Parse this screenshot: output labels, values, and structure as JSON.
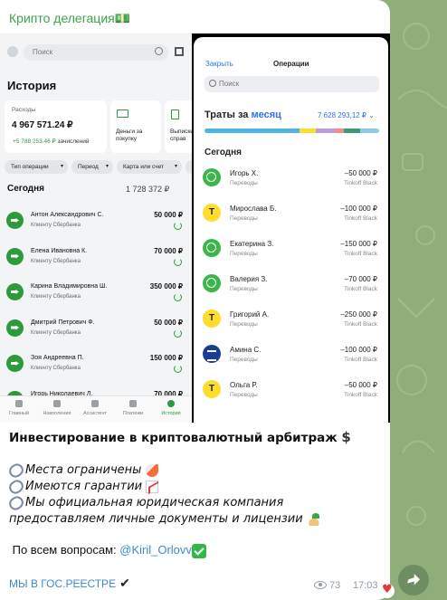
{
  "channel": {
    "title": "Крипто делегация",
    "title_emoji": "💵"
  },
  "sber": {
    "search_placeholder": "Поиск",
    "heading": "История",
    "expenses_label": "Расходы",
    "expenses_value": "4 967 571.24 ₽",
    "income_value": "+5 788 253.46 ₽",
    "income_suffix": "зачислений",
    "pay_card_label": "Деньги за покупку",
    "extract_card_label": "Выписки и справ",
    "filters": [
      "Тип операции",
      "Период",
      "Карта или счет",
      "Т"
    ],
    "today_label": "Сегодня",
    "today_total": "1 728 372 ₽",
    "transactions": [
      {
        "name": "Антон Александрович С.",
        "sub": "Клиенту Сбербанка",
        "amount": "50 000 ₽"
      },
      {
        "name": "Елена Ивановна К.",
        "sub": "Клиенту Сбербанка",
        "amount": "70 000 ₽"
      },
      {
        "name": "Карина Владимировна Ш.",
        "sub": "Клиенту Сбербанка",
        "amount": "350 000 ₽"
      },
      {
        "name": "Дмитрий Петрович Ф.",
        "sub": "Клиенту Сбербанка",
        "amount": "50 000 ₽"
      },
      {
        "name": "Зоя Андреевна П.",
        "sub": "Клиенту Сбербанка",
        "amount": "150 000 ₽"
      },
      {
        "name": "Игорь Николаевич Л.",
        "sub": "Клиенту Сбербанка",
        "amount": "70 000 ₽"
      }
    ],
    "tabs": [
      "Главный",
      "Накопления",
      "Ассистент",
      "Платежи",
      "История"
    ]
  },
  "tinkoff": {
    "header_link": "Закрыть",
    "header_title": "Операции",
    "search_placeholder": "Поиск",
    "spend_label": "Траты за",
    "spend_period": "месяц",
    "spend_total": "7 628 293,12 ₽",
    "today_label": "Сегодня",
    "bar_colors": [
      "#4fb3e6",
      "#ffdd2d",
      "#b99be6",
      "#f28e8e",
      "#3c9a7c",
      "#8ecae6"
    ],
    "transactions": [
      {
        "name": "Игорь Х.",
        "sub": "Переводы",
        "amount": "–50 000 ₽",
        "bank": "Tinkoff Black",
        "icon": "g"
      },
      {
        "name": "Мирослава Б.",
        "sub": "Переводы",
        "amount": "–100 000 ₽",
        "bank": "Tinkoff Black",
        "icon": "y"
      },
      {
        "name": "Екатерина З.",
        "sub": "Переводы",
        "amount": "–150 000 ₽",
        "bank": "Tinkoff Black",
        "icon": "g"
      },
      {
        "name": "Валерия З.",
        "sub": "Переводы",
        "amount": "–70 000 ₽",
        "bank": "Tinkoff Black",
        "icon": "g"
      },
      {
        "name": "Григорий А.",
        "sub": "Переводы",
        "amount": "–250 000 ₽",
        "bank": "Tinkoff Black",
        "icon": "y"
      },
      {
        "name": "Амина С.",
        "sub": "Переводы",
        "amount": "–100 000 ₽",
        "bank": "Tinkoff Black",
        "icon": "b"
      },
      {
        "name": "Ольга Р.",
        "sub": "Переводы",
        "amount": "–50 000 ₽",
        "bank": "Tinkoff Black",
        "icon": "y"
      }
    ]
  },
  "message": {
    "headline": "Инвестирование в криптовалютный арбитраж",
    "line1": "Места ограничены",
    "line2": "Имеются гарантии",
    "line3": "Мы официальная юридическая компания предоставляем личные документы и лицензии",
    "contact_prefix": "По всем вопросам:",
    "contact_handle": "@Kiril_Orlovv",
    "footer": "МЫ В ГОС.РЕЕСТРЕ"
  },
  "meta": {
    "views": "73",
    "time": "17:03"
  },
  "colors": {
    "accent_green": "#3aa546",
    "link_blue": "#3a8ccf",
    "sber_green": "#2e9a3d",
    "tinkoff_blue": "#336fee"
  }
}
